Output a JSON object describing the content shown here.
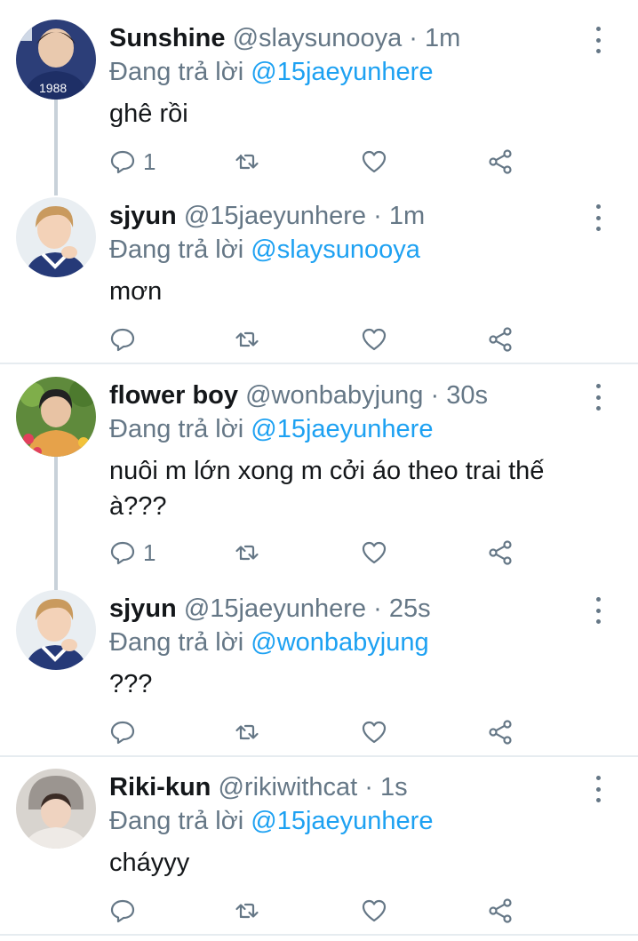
{
  "reply_prefix": "Đang trả lời",
  "tweets": [
    {
      "name": "Sunshine",
      "handle": "@slaysunooya",
      "time": "1m",
      "reply_to": "@15jaeyunhere",
      "text": "ghê rồi",
      "reply_count": "1",
      "avatar": "avatar-sunshine"
    },
    {
      "name": "sjyun",
      "handle": "@15jaeyunhere",
      "time": "1m",
      "reply_to": "@slaysunooya",
      "text": "mơn",
      "reply_count": "",
      "avatar": "avatar-sjyun"
    },
    {
      "name": "flower boy",
      "handle": "@wonbabyjung",
      "time": "30s",
      "reply_to": "@15jaeyunhere",
      "text": "nuôi m lớn xong m cởi áo theo trai thế à???",
      "reply_count": "1",
      "avatar": "avatar-flower-boy"
    },
    {
      "name": "sjyun",
      "handle": "@15jaeyunhere",
      "time": "25s",
      "reply_to": "@wonbabyjung",
      "text": "???",
      "reply_count": "",
      "avatar": "avatar-sjyun"
    },
    {
      "name": "Riki-kun",
      "handle": "@rikiwithcat",
      "time": "1s",
      "reply_to": "@15jaeyunhere",
      "text": "cháyyy",
      "reply_count": "",
      "avatar": "avatar-riki"
    }
  ],
  "colors": {
    "mention": "#1da1f2",
    "muted": "#657786",
    "text": "#14171a",
    "thread_line": "#c8d1d9",
    "divider": "#e6ecf0"
  }
}
